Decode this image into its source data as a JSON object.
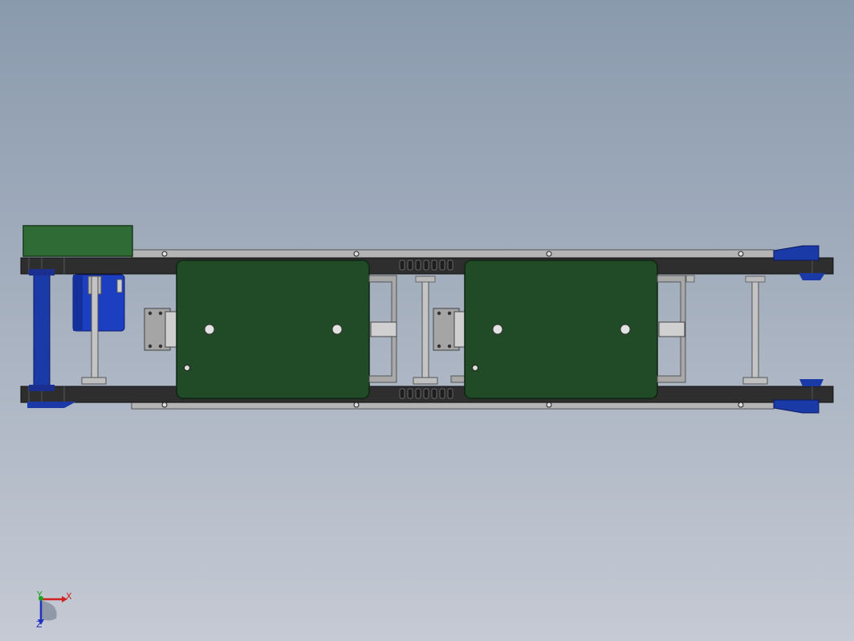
{
  "viewport": {
    "background_top": "#8a9aad",
    "background_bottom": "#c5cad4"
  },
  "model": {
    "colors": {
      "frame_rail": "#2e2e2e",
      "side_plate": "#b0b0b0",
      "green_plate": "#214a26",
      "motor_housing_green": "#2e6b35",
      "blue_parts": "#1a3aa8",
      "bracket_gray": "#9a9a9a",
      "rod_gray": "#c0c0c0"
    }
  },
  "triad": {
    "x_label": "X",
    "y_label": "Y",
    "z_label": "Z",
    "x_color": "#d02020",
    "y_color": "#20a020",
    "z_color": "#2030c0"
  }
}
